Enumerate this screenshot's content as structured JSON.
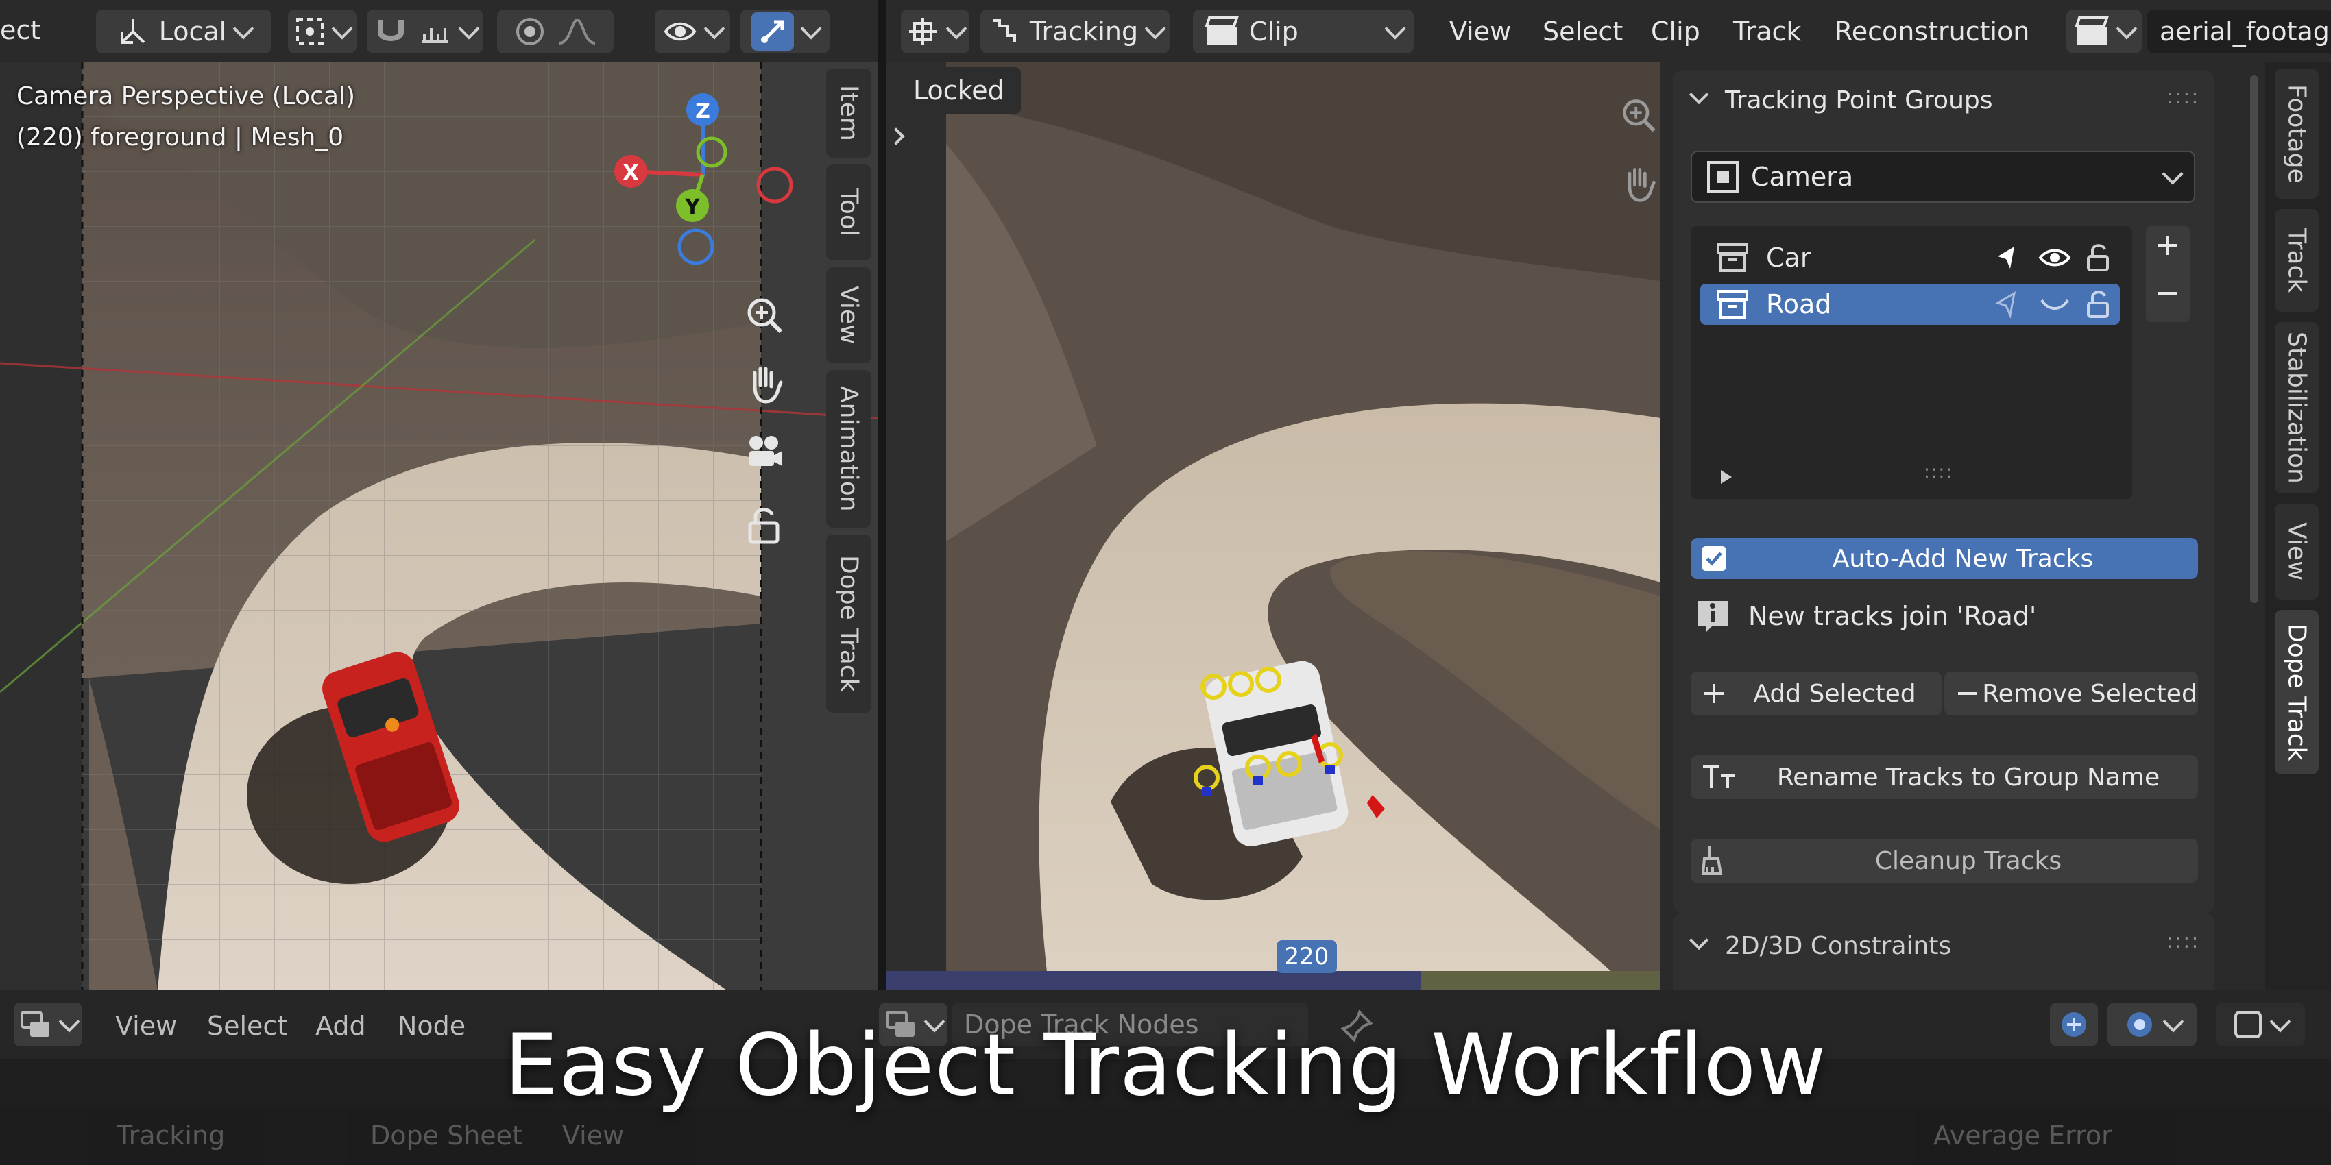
{
  "viewport3d": {
    "header": {
      "left_fragment": "ect",
      "orientation_label": "Local"
    },
    "overlay": {
      "line1": "Camera Perspective (Local)",
      "line2": "(220) foreground | Mesh_0"
    },
    "gizmo": {
      "z": "Z",
      "x": "X",
      "y": "Y"
    },
    "side_tabs": [
      "Item",
      "Tool",
      "View",
      "Animation",
      "Dope Track"
    ]
  },
  "clip_editor": {
    "header": {
      "mode_label": "Tracking",
      "view_label": "Clip",
      "menus": [
        "View",
        "Select",
        "Clip",
        "Track",
        "Reconstruction"
      ],
      "clip_name": "aerial_footage"
    },
    "locked_label": "Locked",
    "frame_number": "220"
  },
  "sidebar": {
    "panel_title": "Tracking Point Groups",
    "target_select": "Camera",
    "groups": [
      {
        "name": "Car",
        "selected": false
      },
      {
        "name": "Road",
        "selected": true
      }
    ],
    "auto_add_label": "Auto-Add New Tracks",
    "auto_add_checked": true,
    "info_text": "New tracks join 'Road'",
    "add_selected_label": "Add Selected",
    "remove_selected_label": "Remove Selected",
    "rename_label": "Rename Tracks to Group Name",
    "cleanup_label": "Cleanup Tracks",
    "constraints_title": "2D/3D Constraints",
    "right_tabs": [
      "Footage",
      "Track",
      "Stabilization",
      "View",
      "Dope Track"
    ],
    "active_tab": "Dope Track",
    "accent_color": "#4772b3"
  },
  "bottom": {
    "node_menus": [
      "View",
      "Select",
      "Add",
      "Node"
    ],
    "node_tree_name": "Dope Track Nodes",
    "dope_menus": [
      "Tracking",
      "Dope Sheet",
      "View"
    ],
    "average_error_label": "Average Error"
  },
  "caption": "Easy Object Tracking Workflow"
}
